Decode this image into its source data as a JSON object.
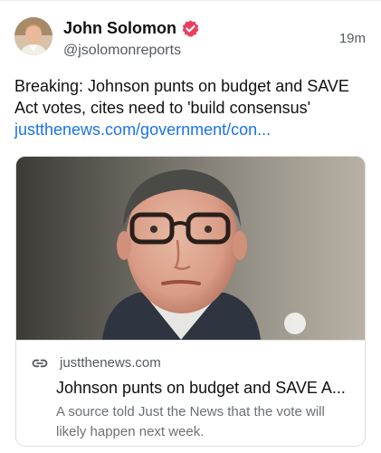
{
  "author": {
    "display_name": "John Solomon",
    "handle": "@jsolomonreports",
    "verified_color": "#e8415f"
  },
  "post": {
    "timestamp": "19m",
    "text_line_1": "Breaking: Johnson punts on budget and SAVE",
    "text_line_2": "Act votes, cites need to 'build consensus'",
    "link_text": "justthenews.com/government/con..."
  },
  "link_card": {
    "domain": "justthenews.com",
    "title": "Johnson punts on budget and SAVE A...",
    "description": "A source told Just the News that the vote will likely happen next week."
  },
  "colors": {
    "link": "#1a73e8",
    "muted_text": "#555a60",
    "border": "#dddddd"
  },
  "icons": {
    "verified": "verified-badge-icon",
    "link": "link-icon"
  }
}
